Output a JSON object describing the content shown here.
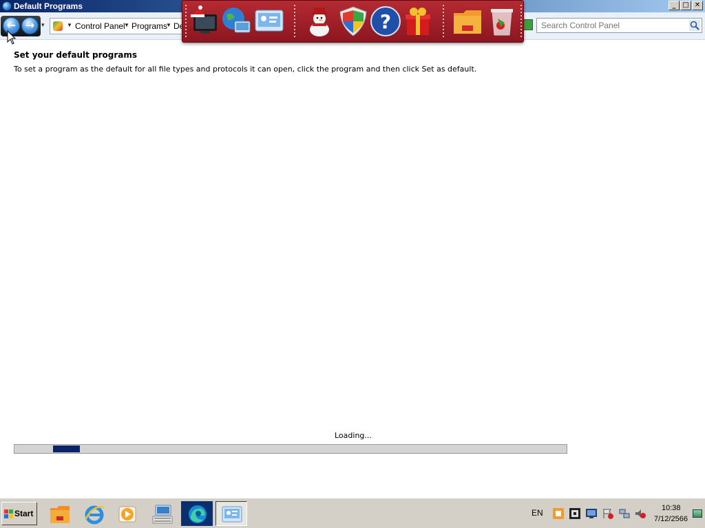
{
  "window": {
    "title": "Default Programs",
    "controls": {
      "minimize": "_",
      "maximize": "□",
      "close": "✕"
    }
  },
  "navbar": {
    "back_icon": "back-arrow-icon",
    "forward_icon": "forward-arrow-icon",
    "history_dropdown": "▾",
    "breadcrumb": [
      {
        "label": "Control Panel"
      },
      {
        "label": "Programs"
      },
      {
        "label": "De"
      }
    ],
    "search": {
      "placeholder": "Search Control Panel",
      "value": ""
    }
  },
  "dock": {
    "icons": [
      "christmas-computer-icon",
      "globe-network-icon",
      "control-panel-icon",
      "snowman-icon",
      "windows-shield-icon",
      "help-icon",
      "gift-icon",
      "folder-icon",
      "recycle-bin-icon"
    ]
  },
  "content": {
    "heading": "Set your default programs",
    "description": "To set a program as the default for all file types and protocols it can open, click the program and then click Set as default.",
    "loading_text": "Loading...",
    "progress_fraction": 0.07
  },
  "taskbar": {
    "start_label": "Start",
    "buttons": [
      "file-explorer-icon",
      "internet-explorer-icon",
      "media-player-icon",
      "keyboard-computer-icon",
      "edge-browser-icon",
      "control-panel-icon"
    ],
    "language": "EN",
    "clock_time": "10:38",
    "clock_date": "7/12/2566"
  }
}
